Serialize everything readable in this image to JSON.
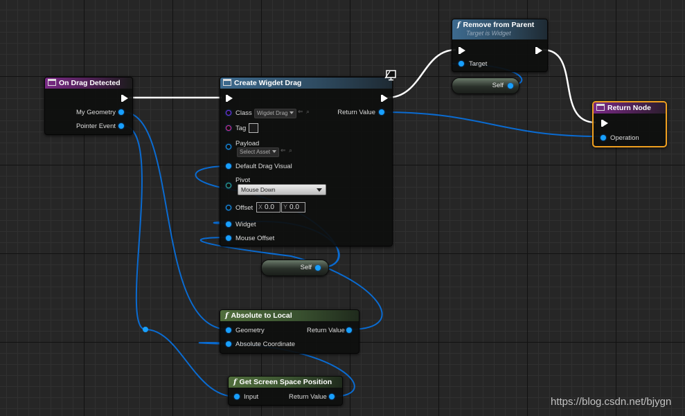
{
  "nodes": {
    "on_drag_detected": {
      "title": "On Drag Detected",
      "pins": {
        "my_geometry": "My Geometry",
        "pointer_event": "Pointer Event"
      }
    },
    "create_widget_drag": {
      "title": "Create Wigdet Drag",
      "pins": {
        "class": "Class",
        "class_value": "Wigdet Drag",
        "tag": "Tag",
        "payload": "Payload",
        "payload_value": "Select Asset",
        "default_drag_visual": "Default Drag Visual",
        "pivot": "Pivot",
        "pivot_value": "Mouse Down",
        "offset": "Offset",
        "offset_x_axis": "X",
        "offset_x": "0.0",
        "offset_y_axis": "Y",
        "offset_y": "0.0",
        "widget": "Widget",
        "mouse_offset": "Mouse Offset",
        "return_value": "Return Value"
      }
    },
    "remove_from_parent": {
      "title": "Remove from Parent",
      "subtitle": "Target is Widget",
      "pins": {
        "target": "Target"
      }
    },
    "return_node": {
      "title": "Return Node",
      "pins": {
        "operation": "Operation"
      }
    },
    "self_top": {
      "label": "Self"
    },
    "self_mid": {
      "label": "Self"
    },
    "absolute_to_local": {
      "title": "Absolute to Local",
      "pins": {
        "geometry": "Geometry",
        "absolute_coordinate": "Absolute Coordinate",
        "return_value": "Return Value"
      }
    },
    "get_screen_space_position": {
      "title": "Get Screen Space Position",
      "pins": {
        "input": "Input",
        "return_value": "Return Value"
      }
    }
  },
  "icons": [
    "event-node-icon",
    "function-icon",
    "monitor-icon",
    "exec-pin-icon",
    "data-pin-icon"
  ],
  "colors": {
    "background": "#262626",
    "exec_wire": "#ffffff",
    "data_wire": "#0a6bd1",
    "data_pin": "#18a0ff",
    "class_pin": "#7b2ff0",
    "tag_pin": "#e02c9a",
    "return_highlight": "#f0a020"
  },
  "watermark": "https://blog.csdn.net/bjygn"
}
